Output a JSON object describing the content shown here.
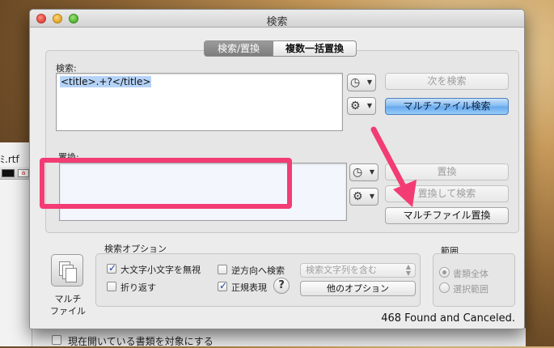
{
  "background": {
    "document_name": "ﾐ.rtf",
    "option_label": "現在開いている書類を対象にする"
  },
  "window": {
    "title": "検索",
    "tabs": [
      {
        "label": "検索/置換",
        "active": true
      },
      {
        "label": "複数一括置換",
        "active": false
      }
    ]
  },
  "search": {
    "label": "検索:",
    "value": "<title>.+?</title>",
    "find_next_button": "次を検索",
    "multi_file_search_button": "マルチファイル検索"
  },
  "replace": {
    "label": "置換:",
    "value": "",
    "replace_button": "置換",
    "replace_and_find_button": "置換して検索",
    "multi_file_replace_button": "マルチファイル置換"
  },
  "icons": {
    "history": "clock-history-icon",
    "gear": "gear-icon",
    "multi_file": "multiple-documents-icon"
  },
  "multi_file": {
    "label_line1": "マルチ",
    "label_line2": "ファイル"
  },
  "options": {
    "group_label": "検索オプション",
    "ignore_case": {
      "label": "大文字小文字を無視",
      "checked": true
    },
    "wrap": {
      "label": "折り返す",
      "checked": false
    },
    "reverse": {
      "label": "逆方向へ検索",
      "checked": false
    },
    "regex": {
      "label": "正規表現",
      "checked": true
    },
    "match_select": "検索文字列を含む",
    "more_options_button": "他のオプション",
    "help": "?"
  },
  "range": {
    "group_label": "範囲",
    "whole_document": "書類全体",
    "selection": "選択範囲"
  },
  "status": "468 Found and Canceled.",
  "colors": {
    "highlight_border": "#f33c74",
    "arrow": "#f33c74",
    "primary_button": "#66a8ee"
  }
}
